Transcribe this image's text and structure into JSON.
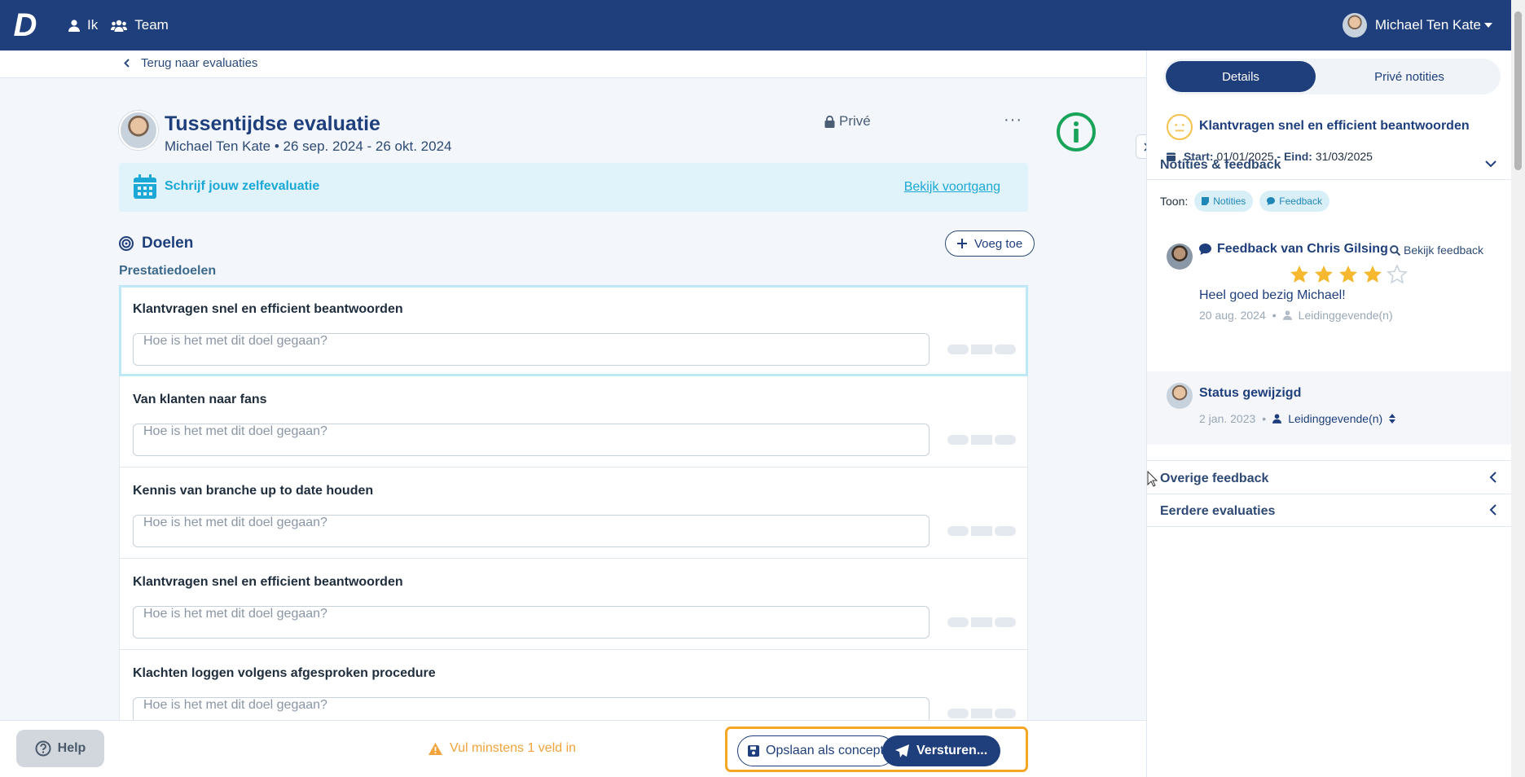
{
  "nav": {
    "logo": "D",
    "items": [
      {
        "label": "Ik",
        "icon": "user-icon"
      },
      {
        "label": "Team",
        "icon": "team-icon"
      }
    ],
    "user_name": "Michael Ten Kate"
  },
  "breadcrumb": {
    "back_label": "Terug naar evaluaties"
  },
  "evaluation": {
    "title": "Tussentijdse evaluatie",
    "subtitle": "Michael Ten Kate • 26 sep. 2024 - 26 okt. 2024",
    "privacy_label": "Privé",
    "more_label": "···"
  },
  "self_eval": {
    "text": "Schrijf jouw zelfevaluatie",
    "link": "Bekijk voortgang"
  },
  "goals": {
    "title": "Doelen",
    "add_label": "Voeg toe",
    "section_label": "Prestatiedoelen",
    "input_placeholder": "Hoe is het met dit doel gegaan?",
    "items": [
      {
        "name": "Klantvragen snel en efficient beantwoorden"
      },
      {
        "name": "Van klanten naar fans"
      },
      {
        "name": "Kennis van branche up to date houden"
      },
      {
        "name": "Klantvragen snel en efficient beantwoorden"
      },
      {
        "name": "Klachten loggen volgens afgesproken procedure"
      }
    ]
  },
  "bottom": {
    "help_label": "Help",
    "warning": "Vul minstens 1 veld in",
    "save_label": "Opslaan als concept",
    "send_label": "Versturen..."
  },
  "sidebar": {
    "tabs": [
      {
        "label": "Details",
        "active": true
      },
      {
        "label": "Privé notities",
        "active": false
      }
    ],
    "goal_title": "Klantvragen snel en efficient beantwoorden",
    "goal_start_label": "Start:",
    "goal_start": "01/01/2025",
    "goal_end_label": "- Eind:",
    "goal_end": "31/03/2025",
    "notes_section": "Notities & feedback",
    "toon_label": "Toon:",
    "filters": [
      "Notities",
      "Feedback"
    ],
    "feedback": {
      "title": "Feedback van Chris Gilsing",
      "link": "Bekijk feedback",
      "rating": 4,
      "max_rating": 5,
      "text": "Heel goed bezig Michael!",
      "date": "20 aug. 2024",
      "audience": "Leidinggevende(n)"
    },
    "status": {
      "title": "Status gewijzigd",
      "date": "2 jan. 2023",
      "audience": "Leidinggevende(n)"
    },
    "other_feedback": "Overige feedback",
    "previous_evaluations": "Eerdere evaluaties"
  },
  "colors": {
    "brand": "#1f3f7c",
    "accent": "#1ba8d6",
    "success": "#1aa45a",
    "warning": "#f0a43b",
    "star": "#f5b82e"
  }
}
